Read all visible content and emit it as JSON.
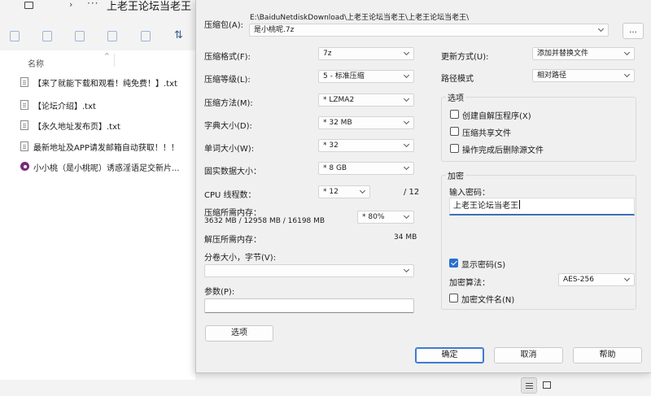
{
  "explorer": {
    "title": "上老王论坛当老王",
    "chevron": "›",
    "more": "···",
    "sort_icon": "⇅",
    "column_header": "名称",
    "files": [
      {
        "name": "【来了就能下载和观看！纯免费！】.txt",
        "icon": "text-file-icon"
      },
      {
        "name": "【论坛介绍】.txt",
        "icon": "text-file-icon"
      },
      {
        "name": "【永久地址发布页】.txt",
        "icon": "text-file-icon"
      },
      {
        "name": "最新地址及APP请发邮箱自动获取！！！",
        "icon": "text-file-icon"
      },
      {
        "name": "小小桃（是小桃呢）诱惑淫语足交新片...",
        "icon": "media-file-icon"
      }
    ]
  },
  "dialog": {
    "archive_label": "压缩包(A):",
    "archive_path": "E:\\BaiduNetdiskDownload\\上老王论坛当老王\\上老王论坛当老王\\",
    "archive_name": "是小桃呢.7z",
    "browse_label": "...",
    "format_label": "压缩格式(F):",
    "format_value": "7z",
    "level_label": "压缩等级(L):",
    "level_value": "5 - 标准压缩",
    "method_label": "压缩方法(M):",
    "method_value": "* LZMA2",
    "dict_label": "字典大小(D):",
    "dict_value": "* 32 MB",
    "word_label": "单词大小(W):",
    "word_value": "* 32",
    "solid_label": "固实数据大小：",
    "solid_value": "* 8 GB",
    "threads_label": "CPU 线程数：",
    "threads_value": "* 12",
    "threads_max": "/ 12",
    "mem_comp_label": "压缩所需内存：",
    "mem_comp_detail": "3632 MB / 12958 MB / 16198 MB",
    "mem_comp_value": "* 80%",
    "mem_decomp_label": "解压所需内存：",
    "mem_decomp_value": "34 MB",
    "volume_label": "分卷大小，字节(V):",
    "volume_value": "",
    "params_label": "参数(P):",
    "params_value": "",
    "options_btn": "选项",
    "update_label": "更新方式(U):",
    "update_value": "添加并替换文件",
    "path_label": "路径模式",
    "path_value": "相对路径",
    "options_group": "选项",
    "opt_sfx": "创建自解压程序(X)",
    "opt_shared": "压缩共享文件",
    "opt_delete": "操作完成后删除源文件",
    "encrypt_group": "加密",
    "password_label": "输入密码：",
    "password_value": "上老王论坛当老王",
    "show_password": "显示密码(S)",
    "enc_method_label": "加密算法：",
    "enc_method_value": "AES-256",
    "encrypt_names": "加密文件名(N)",
    "ok_btn": "确定",
    "cancel_btn": "取消",
    "help_btn": "帮助"
  }
}
